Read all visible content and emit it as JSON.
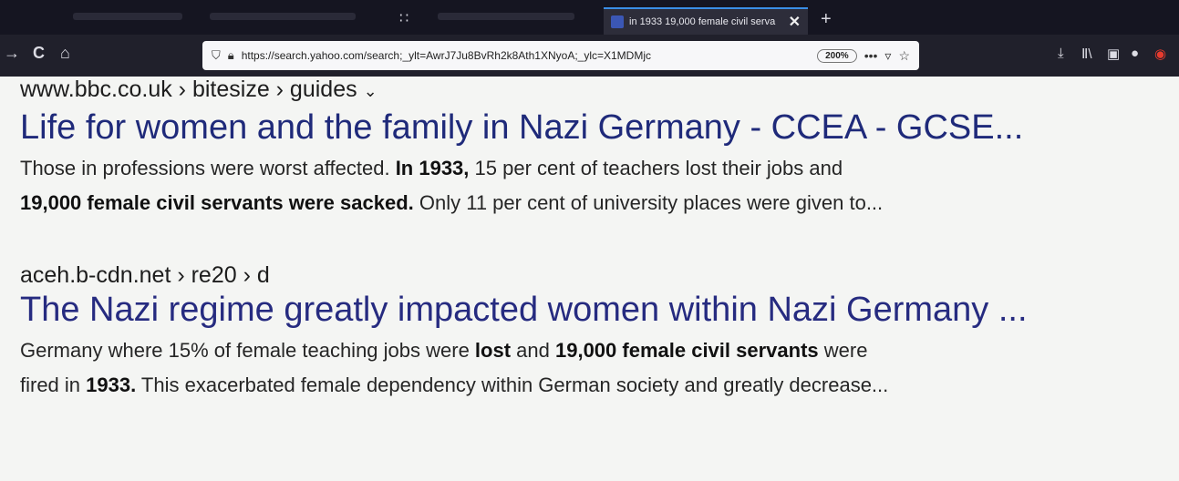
{
  "browser": {
    "active_tab_title": "in 1933 19,000 female civil serva",
    "new_tab_label": "+",
    "url": "https://search.yahoo.com/search;_ylt=AwrJ7Ju8BvRh2k8Ath1XNyoA;_ylc=X1MDMjc",
    "zoom_label": "200%",
    "nav": {
      "back": "→",
      "reload": "C",
      "home": "⌂"
    },
    "url_icons": {
      "shield": "shield-icon",
      "lock": "lock-icon"
    },
    "toolbar_icons": [
      "download-icon",
      "library-icon",
      "sidebar-icon",
      "extension-icon",
      "notification-icon"
    ]
  },
  "results": [
    {
      "breadcrumb": "www.bbc.co.uk › bitesize › guides",
      "title": "Life for women and the family in Nazi Germany - CCEA - GCSE...",
      "snippet_line1": {
        "a": "Those in professions were worst affected. ",
        "b": "In 1933,",
        "c": " 15 per cent of teachers lost their jobs and"
      },
      "snippet_line2": {
        "b": "19,000 female civil servants were sacked.",
        "c": " Only 11 per cent of university places were given to..."
      }
    },
    {
      "breadcrumb": "aceh.b-cdn.net › re20 › d",
      "title": "The Nazi regime greatly impacted women within Nazi Germany ...",
      "snippet_line1": {
        "a": "Germany where 15% of female teaching jobs were ",
        "b": "lost",
        "c": " and ",
        "d": "19,000 female civil servants",
        "e": " were"
      },
      "snippet_line2": {
        "a": "fired in ",
        "b": "1933.",
        "c": " This exacerbated female dependency within German society and greatly decrease..."
      }
    }
  ],
  "colors": {
    "title_link": "#1f2a7a",
    "chrome_dark": "#151521",
    "accent_tab": "#3a8ee6"
  }
}
